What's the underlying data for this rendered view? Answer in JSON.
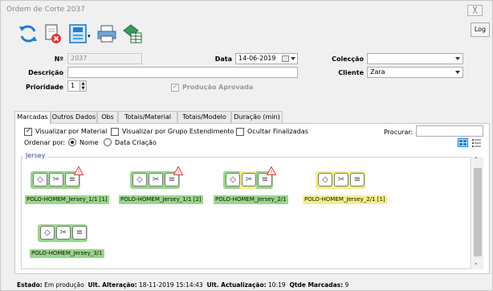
{
  "window": {
    "title": "Ordem de Corte 2037",
    "close_label": "╳"
  },
  "toolbar": {
    "log_label": "Log"
  },
  "form": {
    "numero_label": "Nº",
    "numero_value": "2037",
    "data_label": "Data",
    "data_value": "14-06-2019",
    "coleccao_label": "Colecção",
    "coleccao_value": "",
    "descricao_label": "Descrição",
    "descricao_value": "",
    "cliente_label": "Cliente",
    "cliente_value": "Zara",
    "prioridade_label": "Prioridade",
    "prioridade_value": "1",
    "producao_aprovada_label": "Produção Aprovada"
  },
  "tabs": [
    {
      "label": "Marcadas"
    },
    {
      "label": "Outros Dados"
    },
    {
      "label": "Obs"
    },
    {
      "label": "Totais/Material"
    },
    {
      "label": "Totais/Modelo"
    },
    {
      "label": "Duração (min)"
    }
  ],
  "filters": {
    "visualizar_material": "Visualizar por Material",
    "visualizar_grupo": "Visualizar por Grupo Estendimento",
    "ocultar_finalizadas": "Ocultar Finalizadas",
    "procurar_label": "Procurar:",
    "ordenar_label": "Ordenar por:",
    "nome_label": "Nome",
    "data_criacao_label": "Data Criação"
  },
  "group": {
    "title": "Jersey"
  },
  "cards": [
    {
      "label": "POLO-HOMEM_Jersey_1/1 [1]",
      "has_warning": true,
      "state": "green"
    },
    {
      "label": "POLO-HOMEM_Jersey_1/1 [2]",
      "has_warning": true,
      "state": "green"
    },
    {
      "label": "POLO-HOMEM_Jersey_2/1",
      "has_warning": true,
      "state": "yellow-green"
    },
    {
      "label": "POLO-HOMEM_Jersey_2/1 [1]",
      "has_warning": false,
      "state": "yellow"
    },
    {
      "label": "POLO-HOMEM_Jersey_3/1",
      "has_warning": false,
      "state": "green"
    }
  ],
  "status": {
    "estado_label": "Estado:",
    "estado_value": "Em produção",
    "ult_alteracao_label": "Ult. Alteração:",
    "ult_alteracao_value": "18-11-2019 15:14:43",
    "ult_actualizacao_label": "Ult. Actualização:",
    "ult_actualizacao_value": "10:19",
    "qtde_label": "Qtde Marcadas:",
    "qtde_value": "9"
  },
  "colors": {
    "green": "#9ad68a",
    "yellow": "#f4ef8a",
    "accent_blue": "#1f7fd1",
    "warning_red": "#d93a3a"
  }
}
